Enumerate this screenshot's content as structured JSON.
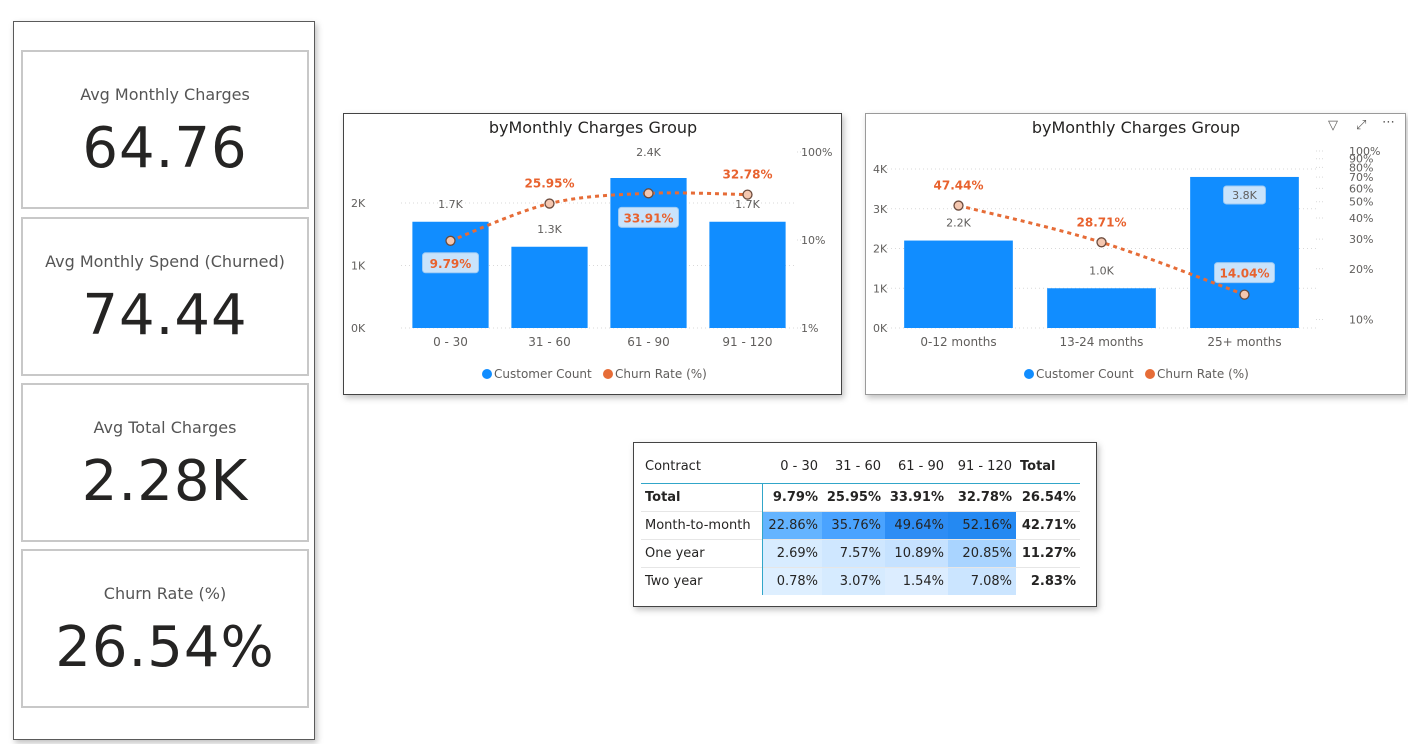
{
  "kpis": [
    {
      "label": "Avg Monthly Charges",
      "value": "64.76"
    },
    {
      "label": "Avg Monthly Spend (Churned)",
      "value": "74.44"
    },
    {
      "label": "Avg Total Charges",
      "value": "2.28K"
    },
    {
      "label": "Churn Rate (%)",
      "value": "26.54%"
    }
  ],
  "chart_data": [
    {
      "type": "bar",
      "title": "byMonthly Charges Group",
      "categories": [
        "0 - 30",
        "31 - 60",
        "61 - 90",
        "91 - 120"
      ],
      "series": [
        {
          "name": "Customer Count",
          "type": "bar",
          "axis": "left",
          "color": "#118DFF",
          "values": [
            1700,
            1300,
            2400,
            1700
          ],
          "labels": [
            "1.7K",
            "1.3K",
            "2.4K",
            "1.7K"
          ]
        },
        {
          "name": "Churn Rate (%)",
          "type": "line",
          "axis": "right",
          "color": "#E66C37",
          "values": [
            9.79,
            25.95,
            33.91,
            32.78
          ],
          "labels": [
            "9.79%",
            "25.95%",
            "33.91%",
            "32.78%"
          ]
        }
      ],
      "left_axis": {
        "ticks": [
          "0K",
          "1K",
          "2K"
        ],
        "ylim": [
          0,
          2000
        ]
      },
      "right_axis": {
        "scale": "log",
        "ticks": [
          "1%",
          "10%",
          "100%"
        ]
      },
      "grid": true,
      "legend": "bottom-center"
    },
    {
      "type": "bar",
      "title": "byMonthly Charges Group",
      "categories": [
        "0-12 months",
        "13-24 months",
        "25+ months"
      ],
      "series": [
        {
          "name": "Customer Count",
          "type": "bar",
          "axis": "left",
          "color": "#118DFF",
          "values": [
            2200,
            1000,
            3800
          ],
          "labels": [
            "2.2K",
            "1.0K",
            "3.8K"
          ]
        },
        {
          "name": "Churn Rate (%)",
          "type": "line",
          "axis": "right",
          "color": "#E66C37",
          "values": [
            47.44,
            28.71,
            14.04
          ],
          "labels": [
            "47.44%",
            "28.71%",
            "14.04%"
          ]
        }
      ],
      "left_axis": {
        "ticks": [
          "0K",
          "1K",
          "2K",
          "3K",
          "4K"
        ],
        "ylim": [
          0,
          4000
        ]
      },
      "right_axis": {
        "scale": "log",
        "ticks": [
          "10%",
          "20%",
          "30%",
          "40%",
          "50%",
          "60%",
          "70%",
          "80%",
          "90%",
          "100%"
        ]
      },
      "grid": true,
      "legend": "bottom-center"
    }
  ],
  "visual_header_icons": [
    "filter-icon",
    "focus-mode-icon",
    "more-options-icon"
  ],
  "matrix": {
    "columns": [
      "Contract",
      "0 - 30",
      "31 - 60",
      "61 - 90",
      "91 - 120",
      "Total"
    ],
    "total_row": {
      "label": "Total",
      "values": [
        "9.79%",
        "25.95%",
        "33.91%",
        "32.78%",
        "26.54%"
      ]
    },
    "rows": [
      {
        "label": "Month-to-month",
        "values": [
          "22.86%",
          "35.76%",
          "49.64%",
          "52.16%",
          "42.71%"
        ],
        "shades": [
          "#64b4ff",
          "#4aa3ff",
          "#2d8df5",
          "#2489f2"
        ]
      },
      {
        "label": "One year",
        "values": [
          "2.69%",
          "7.57%",
          "10.89%",
          "20.85%",
          "11.27%"
        ],
        "shades": [
          "#d8ecff",
          "#cfe7ff",
          "#c6e2ff",
          "#a9d4ff"
        ]
      },
      {
        "label": "Two year",
        "values": [
          "0.78%",
          "3.07%",
          "1.54%",
          "7.08%",
          "2.83%"
        ],
        "shades": [
          "#deefff",
          "#d6ebff",
          "#dcedff",
          "#cbe5ff"
        ]
      }
    ]
  }
}
